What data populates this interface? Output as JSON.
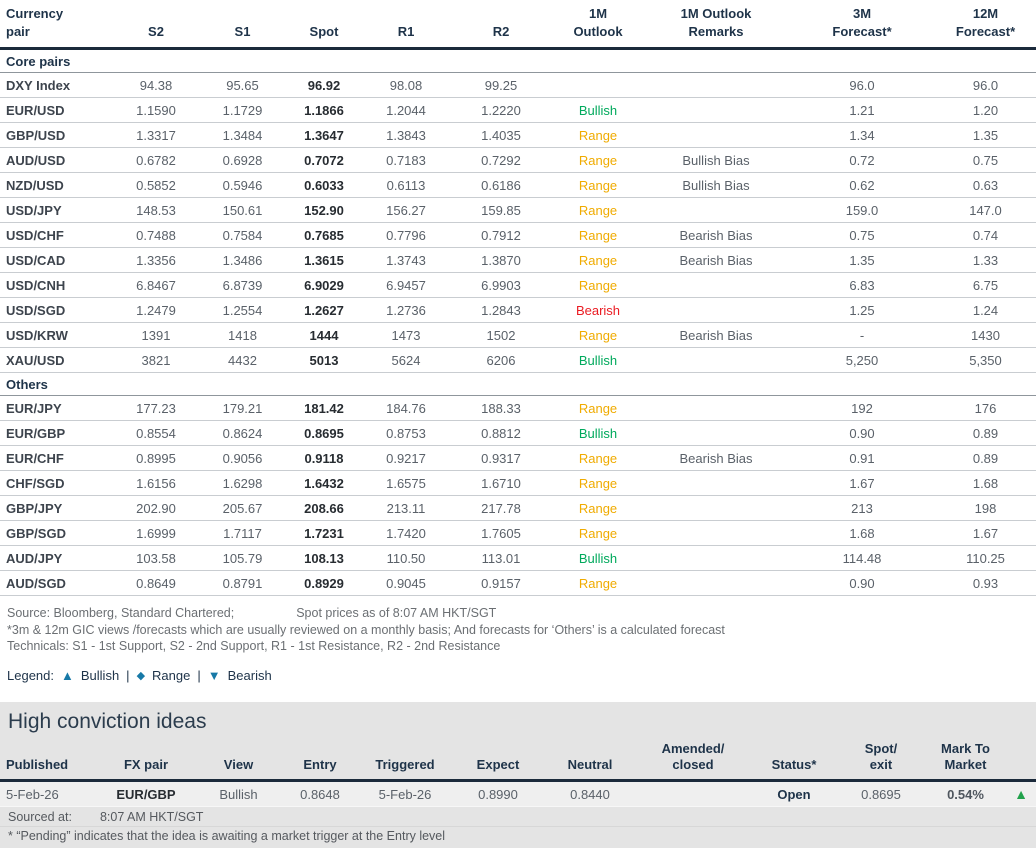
{
  "main_table": {
    "columns": [
      {
        "line1": "Currency",
        "line2": "pair"
      },
      {
        "line1": "",
        "line2": "S2"
      },
      {
        "line1": "",
        "line2": "S1"
      },
      {
        "line1": "",
        "line2": "Spot"
      },
      {
        "line1": "",
        "line2": "R1"
      },
      {
        "line1": "",
        "line2": "R2"
      },
      {
        "line1": "1M",
        "line2": "Outlook"
      },
      {
        "line1": "1M Outlook",
        "line2": "Remarks"
      },
      {
        "line1": "3M",
        "line2": "Forecast*"
      },
      {
        "line1": "12M",
        "line2": "Forecast*"
      }
    ],
    "sections": [
      {
        "label": "Core pairs",
        "rows": [
          {
            "pair": "DXY Index",
            "s2": "94.38",
            "s1": "95.65",
            "spot": "96.92",
            "r1": "98.08",
            "r2": "99.25",
            "outlook": "",
            "remarks": "",
            "m3": "96.0",
            "m12": "96.0"
          },
          {
            "pair": "EUR/USD",
            "s2": "1.1590",
            "s1": "1.1729",
            "spot": "1.1866",
            "r1": "1.2044",
            "r2": "1.2220",
            "outlook": "Bullish",
            "remarks": "",
            "m3": "1.21",
            "m12": "1.20"
          },
          {
            "pair": "GBP/USD",
            "s2": "1.3317",
            "s1": "1.3484",
            "spot": "1.3647",
            "r1": "1.3843",
            "r2": "1.4035",
            "outlook": "Range",
            "remarks": "",
            "m3": "1.34",
            "m12": "1.35"
          },
          {
            "pair": "AUD/USD",
            "s2": "0.6782",
            "s1": "0.6928",
            "spot": "0.7072",
            "r1": "0.7183",
            "r2": "0.7292",
            "outlook": "Range",
            "remarks": "Bullish Bias",
            "m3": "0.72",
            "m12": "0.75"
          },
          {
            "pair": "NZD/USD",
            "s2": "0.5852",
            "s1": "0.5946",
            "spot": "0.6033",
            "r1": "0.6113",
            "r2": "0.6186",
            "outlook": "Range",
            "remarks": "Bullish Bias",
            "m3": "0.62",
            "m12": "0.63"
          },
          {
            "pair": "USD/JPY",
            "s2": "148.53",
            "s1": "150.61",
            "spot": "152.90",
            "r1": "156.27",
            "r2": "159.85",
            "outlook": "Range",
            "remarks": "",
            "m3": "159.0",
            "m12": "147.0"
          },
          {
            "pair": "USD/CHF",
            "s2": "0.7488",
            "s1": "0.7584",
            "spot": "0.7685",
            "r1": "0.7796",
            "r2": "0.7912",
            "outlook": "Range",
            "remarks": "Bearish Bias",
            "m3": "0.75",
            "m12": "0.74"
          },
          {
            "pair": "USD/CAD",
            "s2": "1.3356",
            "s1": "1.3486",
            "spot": "1.3615",
            "r1": "1.3743",
            "r2": "1.3870",
            "outlook": "Range",
            "remarks": "Bearish Bias",
            "m3": "1.35",
            "m12": "1.33"
          },
          {
            "pair": "USD/CNH",
            "s2": "6.8467",
            "s1": "6.8739",
            "spot": "6.9029",
            "r1": "6.9457",
            "r2": "6.9903",
            "outlook": "Range",
            "remarks": "",
            "m3": "6.83",
            "m12": "6.75"
          },
          {
            "pair": "USD/SGD",
            "s2": "1.2479",
            "s1": "1.2554",
            "spot": "1.2627",
            "r1": "1.2736",
            "r2": "1.2843",
            "outlook": "Bearish",
            "remarks": "",
            "m3": "1.25",
            "m12": "1.24"
          },
          {
            "pair": "USD/KRW",
            "s2": "1391",
            "s1": "1418",
            "spot": "1444",
            "r1": "1473",
            "r2": "1502",
            "outlook": "Range",
            "remarks": "Bearish Bias",
            "m3": "-",
            "m12": "1430"
          },
          {
            "pair": "XAU/USD",
            "s2": "3821",
            "s1": "4432",
            "spot": "5013",
            "r1": "5624",
            "r2": "6206",
            "outlook": "Bullish",
            "remarks": "",
            "m3": "5,250",
            "m12": "5,350"
          }
        ]
      },
      {
        "label": "Others",
        "rows": [
          {
            "pair": "EUR/JPY",
            "s2": "177.23",
            "s1": "179.21",
            "spot": "181.42",
            "r1": "184.76",
            "r2": "188.33",
            "outlook": "Range",
            "remarks": "",
            "m3": "192",
            "m12": "176"
          },
          {
            "pair": "EUR/GBP",
            "s2": "0.8554",
            "s1": "0.8624",
            "spot": "0.8695",
            "r1": "0.8753",
            "r2": "0.8812",
            "outlook": "Bullish",
            "remarks": "",
            "m3": "0.90",
            "m12": "0.89"
          },
          {
            "pair": "EUR/CHF",
            "s2": "0.8995",
            "s1": "0.9056",
            "spot": "0.9118",
            "r1": "0.9217",
            "r2": "0.9317",
            "outlook": "Range",
            "remarks": "Bearish Bias",
            "m3": "0.91",
            "m12": "0.89"
          },
          {
            "pair": "CHF/SGD",
            "s2": "1.6156",
            "s1": "1.6298",
            "spot": "1.6432",
            "r1": "1.6575",
            "r2": "1.6710",
            "outlook": "Range",
            "remarks": "",
            "m3": "1.67",
            "m12": "1.68"
          },
          {
            "pair": "GBP/JPY",
            "s2": "202.90",
            "s1": "205.67",
            "spot": "208.66",
            "r1": "213.11",
            "r2": "217.78",
            "outlook": "Range",
            "remarks": "",
            "m3": "213",
            "m12": "198"
          },
          {
            "pair": "GBP/SGD",
            "s2": "1.6999",
            "s1": "1.7117",
            "spot": "1.7231",
            "r1": "1.7420",
            "r2": "1.7605",
            "outlook": "Range",
            "remarks": "",
            "m3": "1.68",
            "m12": "1.67"
          },
          {
            "pair": "AUD/JPY",
            "s2": "103.58",
            "s1": "105.79",
            "spot": "108.13",
            "r1": "110.50",
            "r2": "113.01",
            "outlook": "Bullish",
            "remarks": "",
            "m3": "114.48",
            "m12": "110.25"
          },
          {
            "pair": "AUD/SGD",
            "s2": "0.8649",
            "s1": "0.8791",
            "spot": "0.8929",
            "r1": "0.9045",
            "r2": "0.9157",
            "outlook": "Range",
            "remarks": "",
            "m3": "0.90",
            "m12": "0.93"
          }
        ]
      }
    ]
  },
  "notes": {
    "source_left": "Source: Bloomberg, Standard Chartered;",
    "source_right": "Spot prices as of 8:07 AM HKT/SGT",
    "note1": "*3m & 12m GIC views /forecasts which are usually reviewed on a monthly basis; And forecasts for ‘Others’ is a calculated forecast",
    "note2": "Technicals: S1 - 1st Support, S2 - 2nd Support, R1 - 1st Resistance, R2 - 2nd Resistance"
  },
  "legend": {
    "label": "Legend:",
    "bullish_symbol": "▲",
    "bullish_text": "Bullish",
    "sep1": "|",
    "range_symbol": "◆",
    "range_text": "Range",
    "sep2": "|",
    "bearish_symbol": "▼",
    "bearish_text": "Bearish"
  },
  "high_conviction": {
    "title": "High conviction ideas",
    "columns": [
      {
        "line1": "",
        "line2": "Published"
      },
      {
        "line1": "",
        "line2": "FX pair"
      },
      {
        "line1": "",
        "line2": "View"
      },
      {
        "line1": "",
        "line2": "Entry"
      },
      {
        "line1": "",
        "line2": "Triggered"
      },
      {
        "line1": "",
        "line2": "Expect"
      },
      {
        "line1": "",
        "line2": "Neutral"
      },
      {
        "line1": "Amended/",
        "line2": "closed"
      },
      {
        "line1": "",
        "line2": "Status*"
      },
      {
        "line1": "Spot/",
        "line2": "exit"
      },
      {
        "line1": "Mark To",
        "line2": "Market"
      },
      {
        "line1": "",
        "line2": ""
      }
    ],
    "row": {
      "published": "5-Feb-26",
      "fx_pair": "EUR/GBP",
      "view": "Bullish",
      "entry": "0.8648",
      "triggered": "5-Feb-26",
      "expect": "0.8990",
      "neutral": "0.8440",
      "amended": "",
      "status": "Open",
      "spot_exit": "0.8695",
      "mark_to_market": "0.54%",
      "direction_symbol": "▲"
    },
    "sourced_label": "Sourced at:",
    "sourced_time": "8:07 AM HKT/SGT",
    "pending_note": "* “Pending” indicates that the idea is awaiting a market trigger at the Entry level"
  },
  "colors": {
    "bullish_green": "#00a95c",
    "range_amber": "#f0ab00",
    "bearish_red": "#ea1b22",
    "header_navy": "#1e3349",
    "legend_teal": "#1779a7",
    "panel_gray": "#e4e4e4",
    "mtm_triangle_green": "#21a14b"
  }
}
